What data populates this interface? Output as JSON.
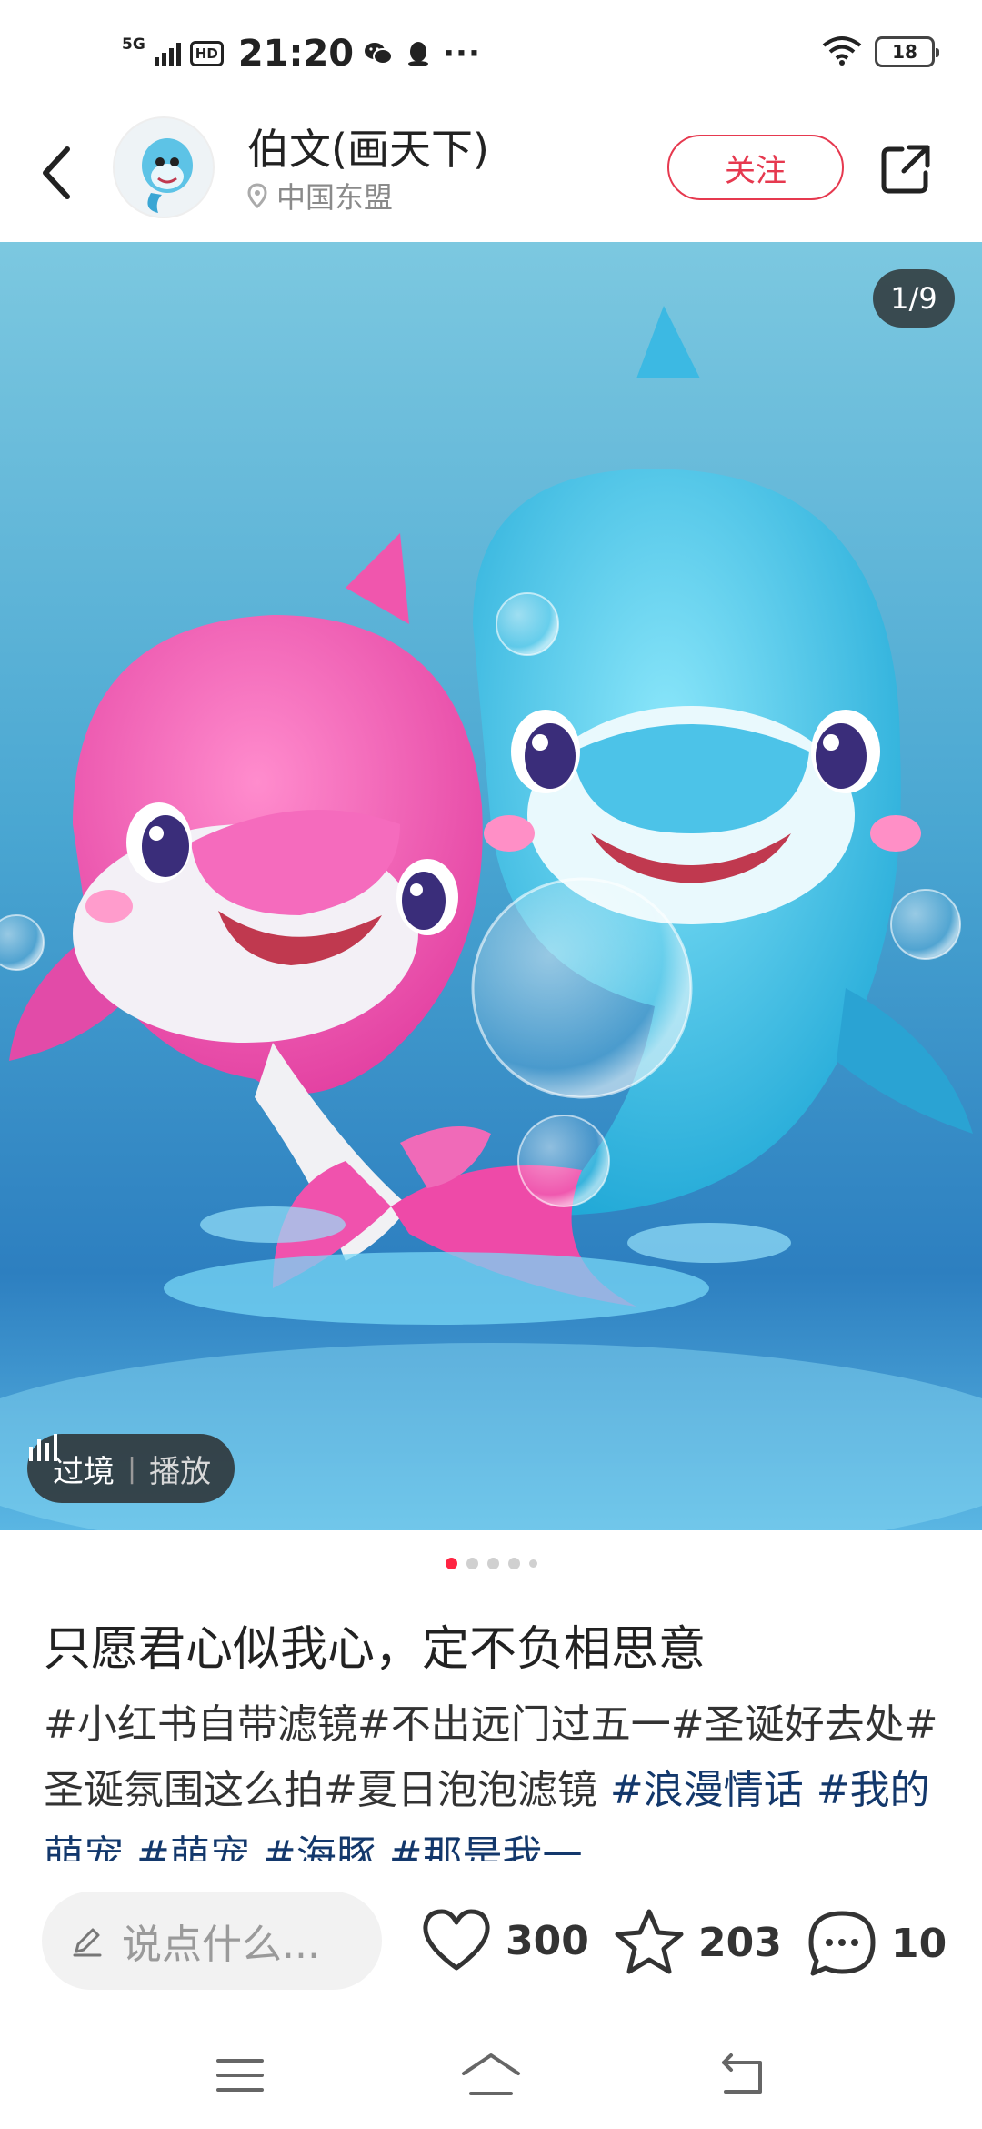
{
  "status_bar": {
    "network": "5G",
    "hd": "HD",
    "time": "21:20",
    "more": "···",
    "battery": "18"
  },
  "header": {
    "author_name": "伯文(画天下)",
    "location": "中国东盟",
    "follow_label": "关注"
  },
  "image": {
    "counter": "1/9",
    "bgm_name": "过境",
    "bgm_sep": "|",
    "bgm_action": "播放"
  },
  "pagination": {
    "current": 1
  },
  "post": {
    "title": "只愿君心似我心，定不负相思意",
    "desc_plain": "#小红书自带滤镜#不出远门过五一#圣诞好去处#圣诞氛围这么拍#夏日泡泡滤镜 ",
    "desc_tags": "#浪漫情话 #我的萌宠 #萌宠 #海豚 #那是我一"
  },
  "actions": {
    "comment_placeholder": "说点什么...",
    "likes": "300",
    "collects": "203",
    "comments": "10"
  },
  "colors": {
    "accent": "#ff2442",
    "follow": "#e6394f",
    "tag": "#13386c"
  }
}
